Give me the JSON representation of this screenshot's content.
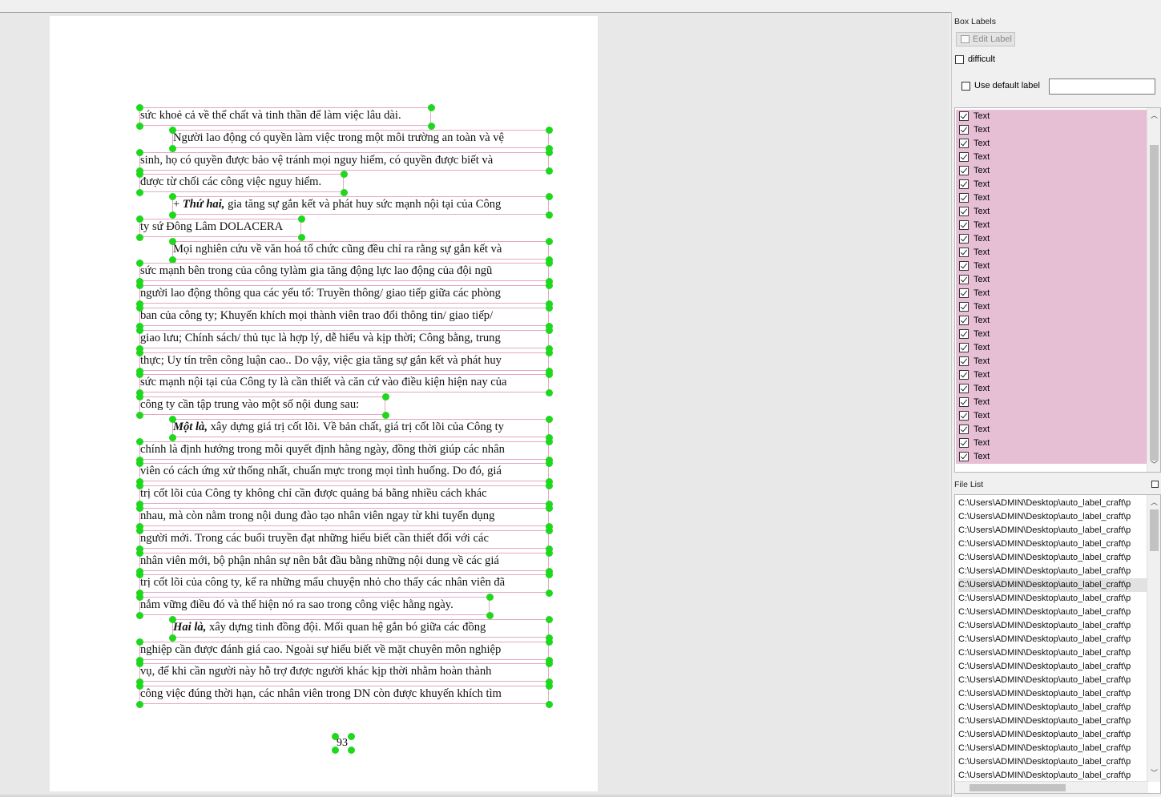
{
  "document": {
    "lines": [
      "sức khoẻ cả về thể chất và tinh thần để làm việc lâu dài.",
      "Người lao động có quyền làm việc trong một môi trường an toàn và vệ",
      "sinh, họ có quyền được bảo vệ tránh mọi nguy hiểm, có quyền được biết và",
      "được từ chối các công việc nguy hiểm.",
      "+ Thứ hai, gia tăng sự gắn kết và phát huy sức mạnh nội tại của Công",
      "ty sứ Đông Lâm DOLACERA",
      "Mọi nghiên cứu về văn hoá tổ chức cũng đều chỉ ra rằng sự gắn kết và",
      "sức mạnh bên trong của công tylàm gia tăng động lực lao động của đội ngũ",
      "người lao động thông qua các yếu tố: Truyền thông/ giao tiếp giữa các phòng",
      "ban của công ty; Khuyến khích mọi thành viên trao đổi thông tin/ giao tiếp/",
      "giao lưu; Chính sách/ thủ tục là hợp lý, dễ hiểu và kịp thời; Công bằng, trung",
      "thực; Uy tín trên công luận cao.. Do vậy, việc gia tăng sự gắn kết và phát huy",
      "sức mạnh nội tại của Công ty là cần thiết và căn cứ vào điều kiện hiện nay của",
      "công ty cần tập trung vào một số nội dung sau:",
      "Một là, xây dựng giá trị cốt lõi. Về bản chất, giá trị cốt lõi của Công ty",
      "chính là định hướng trong mỗi quyết định hằng ngày, đồng thời giúp các nhân",
      "viên có cách ứng xử thống nhất, chuẩn mực trong mọi tình huống. Do đó, giá",
      "trị cốt lõi của Công ty không chỉ cần được quảng bá bằng nhiều cách khác",
      "nhau, mà còn nằm trong nội dung đào tạo nhân viên ngay từ khi tuyển dụng",
      "người mới. Trong các buổi truyền đạt những hiểu biết cần thiết đối với các",
      "nhân viên mới, bộ phận nhân sự nên bắt đầu bằng những nội dung về các giá",
      "trị cốt lõi của công ty, kể ra những mẩu chuyện nhỏ cho thấy các nhân viên đã",
      "nắm vững điều đó và thể hiện nó ra sao trong công việc hằng ngày.",
      "Hai là, xây dựng tinh đồng đội. Mối quan hệ gắn bó giữa các đồng",
      "nghiệp cần được đánh giá cao. Ngoài sự hiểu biết về mặt chuyên môn nghiệp",
      "vụ, để khi cần người này hỗ trợ được người khác kịp thời nhằm hoàn thành",
      "công việc đúng thời hạn, các nhân viên trong DN còn được khuyến khích tìm"
    ],
    "page_number": "93"
  },
  "panel": {
    "box_labels_title": "Box Labels",
    "edit_label": "Edit Label",
    "difficult": "difficult",
    "use_default_label": "Use default label",
    "default_label_value": "",
    "file_list_title": "File List"
  },
  "labels": [
    "Text",
    "Text",
    "Text",
    "Text",
    "Text",
    "Text",
    "Text",
    "Text",
    "Text",
    "Text",
    "Text",
    "Text",
    "Text",
    "Text",
    "Text",
    "Text",
    "Text",
    "Text",
    "Text",
    "Text",
    "Text",
    "Text",
    "Text",
    "Text",
    "Text",
    "Text"
  ],
  "files": [
    "C:\\Users\\ADMIN\\Desktop\\auto_label_craft\\p",
    "C:\\Users\\ADMIN\\Desktop\\auto_label_craft\\p",
    "C:\\Users\\ADMIN\\Desktop\\auto_label_craft\\p",
    "C:\\Users\\ADMIN\\Desktop\\auto_label_craft\\p",
    "C:\\Users\\ADMIN\\Desktop\\auto_label_craft\\p",
    "C:\\Users\\ADMIN\\Desktop\\auto_label_craft\\p",
    "C:\\Users\\ADMIN\\Desktop\\auto_label_craft\\p",
    "C:\\Users\\ADMIN\\Desktop\\auto_label_craft\\p",
    "C:\\Users\\ADMIN\\Desktop\\auto_label_craft\\p",
    "C:\\Users\\ADMIN\\Desktop\\auto_label_craft\\p",
    "C:\\Users\\ADMIN\\Desktop\\auto_label_craft\\p",
    "C:\\Users\\ADMIN\\Desktop\\auto_label_craft\\p",
    "C:\\Users\\ADMIN\\Desktop\\auto_label_craft\\p",
    "C:\\Users\\ADMIN\\Desktop\\auto_label_craft\\p",
    "C:\\Users\\ADMIN\\Desktop\\auto_label_craft\\p",
    "C:\\Users\\ADMIN\\Desktop\\auto_label_craft\\p",
    "C:\\Users\\ADMIN\\Desktop\\auto_label_craft\\p",
    "C:\\Users\\ADMIN\\Desktop\\auto_label_craft\\p",
    "C:\\Users\\ADMIN\\Desktop\\auto_label_craft\\p",
    "C:\\Users\\ADMIN\\Desktop\\auto_label_craft\\p",
    "C:\\Users\\ADMIN\\Desktop\\auto_label_craft\\p"
  ],
  "selected_file_index": 6,
  "colors": {
    "box_outline": "#e3a8c4",
    "vertex": "#1ed81e",
    "label_highlight": "#e7bfd5"
  }
}
